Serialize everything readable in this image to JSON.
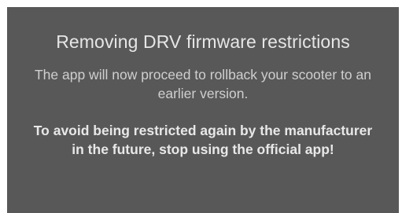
{
  "dialog": {
    "title": "Removing DRV firmware restrictions",
    "message": "The app will now proceed to rollback your scooter to an earlier version.",
    "warning": "To avoid being restricted again by the manufacturer in the future, stop using the official app!"
  },
  "colors": {
    "dialog_background": "#585858",
    "page_background": "#ffffff"
  }
}
